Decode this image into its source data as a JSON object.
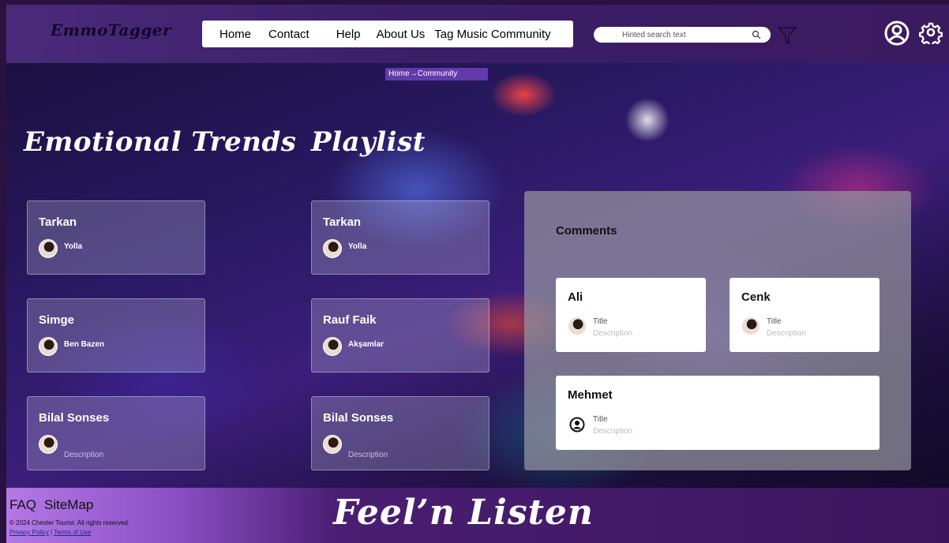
{
  "header": {
    "logo": "EmmoTagger",
    "nav": [
      "Home",
      "Contact",
      "Help",
      "About Us",
      "Tag Music",
      "Community"
    ],
    "search_placeholder": "Hinted search text"
  },
  "breadcrumb": {
    "home": "Home",
    "current": "Community"
  },
  "sections": {
    "trends_title": "Emotional Trends",
    "playlist_title": "Playlist"
  },
  "trends": [
    {
      "artist": "Tarkan",
      "song": "Yolla"
    },
    {
      "artist": "Simge",
      "song": "Ben Bazen"
    },
    {
      "artist": "Bilal Sonses",
      "song": "Description"
    }
  ],
  "playlist": [
    {
      "artist": "Tarkan",
      "song": "Yolla"
    },
    {
      "artist": "Rauf Faik",
      "song": "Akşamlar"
    },
    {
      "artist": "Bilal Sonses",
      "song": "Description"
    }
  ],
  "comments": {
    "title": "Comments",
    "items": [
      {
        "name": "Ali",
        "title": "Title",
        "description": "Description"
      },
      {
        "name": "Cenk",
        "title": "Title",
        "description": "Description"
      },
      {
        "name": "Mehmet",
        "title": "Title",
        "description": "Description"
      }
    ]
  },
  "footer": {
    "faq": "FAQ",
    "sitemap": "SiteMap",
    "copyright": "© 2024 Chester Tourist. All rights reserved.",
    "privacy": "Privacy Policy",
    "separator": "|",
    "terms": "Terms of Use",
    "slogan": "Feel’n Listen"
  },
  "colors": {
    "header_bg": "#4a2a7a",
    "footer_accent": "#b478e6",
    "breadcrumb_bg": "#7846c8"
  }
}
